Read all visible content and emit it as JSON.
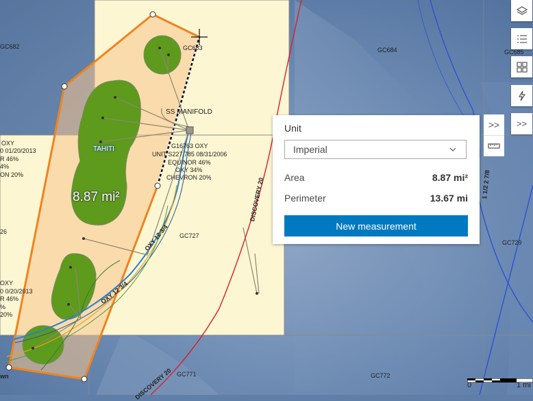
{
  "map": {
    "blocks": [
      "GC682",
      "GC683",
      "GC684",
      "GC685",
      "GC727",
      "GC729",
      "GC771",
      "GC772"
    ],
    "field_name": "TAHITI",
    "manifold_label": "SS MANIFOLD",
    "lease_info_main": [
      "G16763 OXY",
      "UNIT S227,785 08/31/2006",
      "EQUINOR 46%",
      "OXY 34%",
      "CHEVRON 20%"
    ],
    "lease_info_left_top": [
      "OXY",
      "0 01/20/2013",
      "R 46%",
      "4%",
      "ON 20%"
    ],
    "lease_info_left_bottom": [
      "OXY",
      "0 0/20/2013",
      "R 46%",
      "%",
      "20%"
    ],
    "left_num": "26",
    "pipelines": [
      "DISCOVERY 20",
      "OXY 12 3/4",
      "OXY 12 3/4",
      "DISCOVERY 20",
      "1 1/2 2 7/8"
    ],
    "left_edge_text": "wn",
    "area_label": "8.87 mi²",
    "scale": {
      "zero": "0",
      "one": "1 mi"
    }
  },
  "toolbar": {
    "tools": [
      {
        "icon": "layers-icon"
      },
      {
        "icon": "legend-icon"
      },
      {
        "icon": "basemap-gallery-icon"
      },
      {
        "icon": "lightning-icon"
      },
      {
        "icon": "expand-icon",
        "label": ">>"
      }
    ]
  },
  "measure_panel": {
    "unit_label": "Unit",
    "unit_value": "Imperial",
    "area_label": "Area",
    "area_value": "8.87 mi²",
    "perimeter_label": "Perimeter",
    "perimeter_value": "13.67 mi",
    "new_button": "New measurement",
    "collapse_label": ">>"
  }
}
